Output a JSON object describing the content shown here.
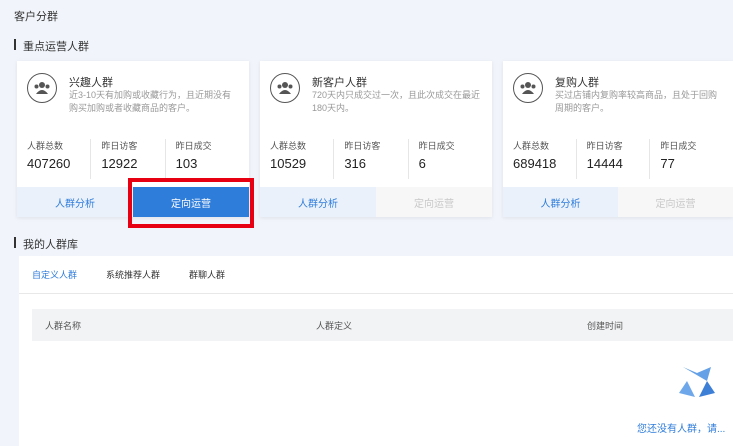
{
  "page": {
    "title": "客户分群"
  },
  "featured": {
    "title": "重点运营人群",
    "cards": [
      {
        "name": "兴趣人群",
        "desc": "近3-10天有加购或收藏行为，且近期没有购买加购或者收藏商品的客户。",
        "stats": [
          {
            "label": "人群总数",
            "value": "407260"
          },
          {
            "label": "昨日访客",
            "value": "12922"
          },
          {
            "label": "昨日成交",
            "value": "103"
          }
        ],
        "analysis_label": "人群分析",
        "target_label": "定向运营"
      },
      {
        "name": "新客户人群",
        "desc": "720天内只成交过一次，且此次成交在最近180天内。",
        "stats": [
          {
            "label": "人群总数",
            "value": "10529"
          },
          {
            "label": "昨日访客",
            "value": "316"
          },
          {
            "label": "昨日成交",
            "value": "6"
          }
        ],
        "analysis_label": "人群分析",
        "target_label": "定向运营"
      },
      {
        "name": "复购人群",
        "desc": "买过店铺内复购率较高商品，且处于回购周期的客户。",
        "stats": [
          {
            "label": "人群总数",
            "value": "689418"
          },
          {
            "label": "昨日访客",
            "value": "14444"
          },
          {
            "label": "昨日成交",
            "value": "77"
          }
        ],
        "analysis_label": "人群分析",
        "target_label": "定向运营"
      }
    ]
  },
  "library": {
    "title": "我的人群库",
    "tabs": [
      "自定义人群",
      "系统推荐人群",
      "群聊人群"
    ],
    "columns": [
      "人群名称",
      "人群定义",
      "创建时间"
    ],
    "empty_text": "您还没有人群，请..."
  },
  "colors": {
    "accent": "#2f7ddb",
    "highlight": "#e60012"
  }
}
